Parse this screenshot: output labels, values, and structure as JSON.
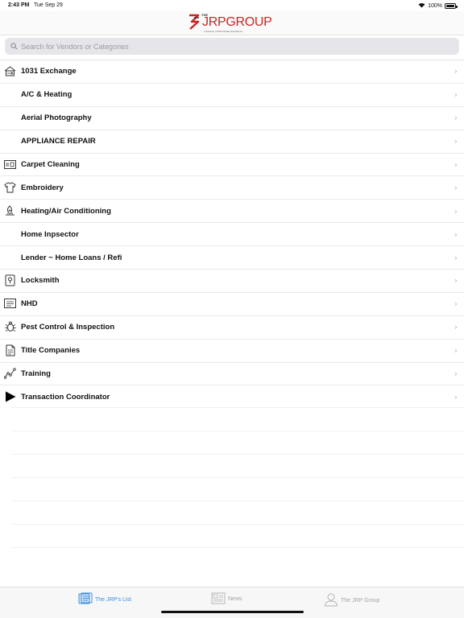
{
  "status_bar": {
    "time": "2:43 PM",
    "date": "Tue Sep 29",
    "battery": "100%"
  },
  "header": {
    "logo_the": "THE",
    "logo_text": "JRPGROUP",
    "logo_tagline": "A Division of Real Estate Excellence"
  },
  "search": {
    "placeholder": "Search for Vendors or Categories",
    "value": ""
  },
  "categories": [
    {
      "label": "1031 Exchange",
      "icon": "exchange-icon"
    },
    {
      "label": "A/C & Heating",
      "icon": ""
    },
    {
      "label": "Aerial Photography",
      "icon": ""
    },
    {
      "label": "APPLIANCE REPAIR",
      "icon": ""
    },
    {
      "label": "Carpet Cleaning",
      "icon": "carpet-icon"
    },
    {
      "label": "Embroidery",
      "icon": "shirt-icon"
    },
    {
      "label": "Heating/Air Conditioning",
      "icon": "flame-icon"
    },
    {
      "label": "Home Inpsector",
      "icon": ""
    },
    {
      "label": "Lender ~ Home Loans / Refi",
      "icon": ""
    },
    {
      "label": "Locksmith",
      "icon": "lock-icon"
    },
    {
      "label": "NHD",
      "icon": "document-icon"
    },
    {
      "label": "Pest Control & Inspection",
      "icon": "bug-icon"
    },
    {
      "label": "Title Companies",
      "icon": "title-doc-icon"
    },
    {
      "label": "Training",
      "icon": "chart-line-icon"
    },
    {
      "label": "Transaction Coordinator",
      "icon": "play-icon"
    }
  ],
  "chevron": "›",
  "tabs": [
    {
      "label": "The JRP's List",
      "icon": "list-icon",
      "active": true
    },
    {
      "label": "News",
      "icon": "news-icon",
      "active": false
    },
    {
      "label": "The JRP Group",
      "icon": "person-icon",
      "active": false
    }
  ],
  "colors": {
    "brand_red": "#c62828",
    "tab_active": "#3d8fe0",
    "tab_inactive": "#a4a4a4"
  }
}
